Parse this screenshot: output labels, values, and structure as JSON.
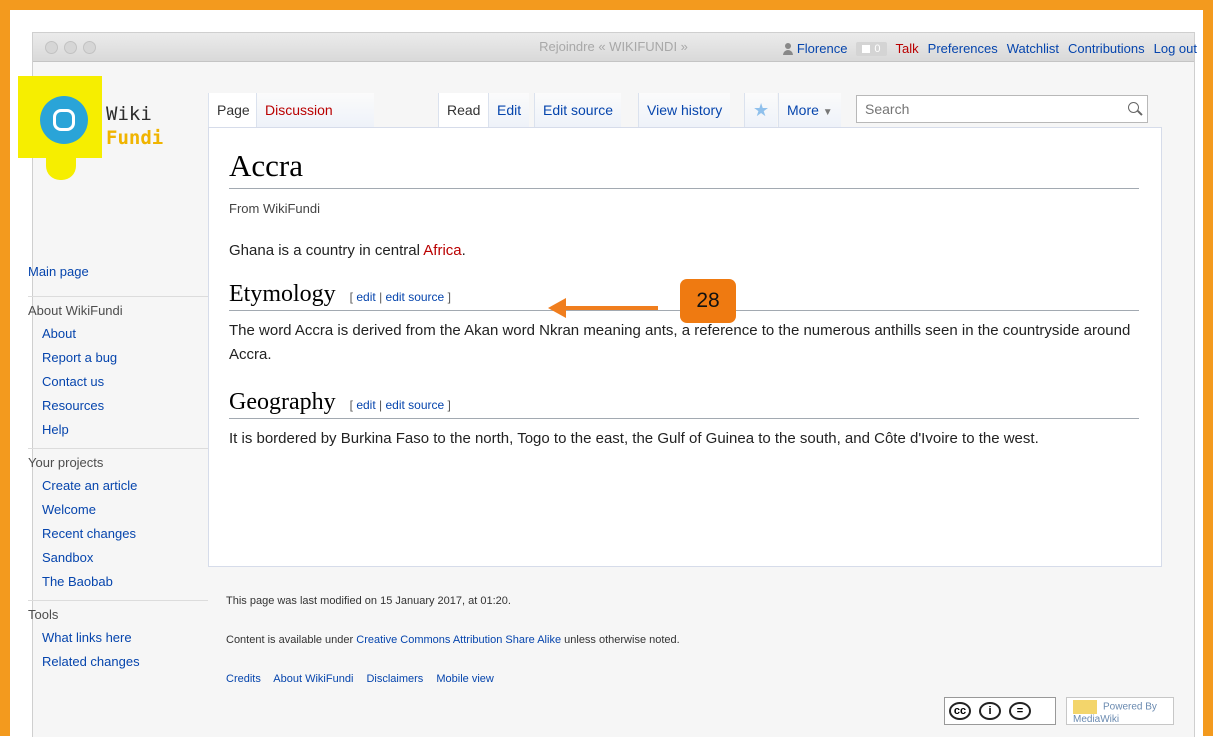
{
  "window": {
    "title": "Rejoindre « WIKIFUNDI »"
  },
  "personal": {
    "user": "Florence",
    "notifications": "0",
    "talk": "Talk",
    "preferences": "Preferences",
    "watchlist": "Watchlist",
    "contributions": "Contributions",
    "logout": "Log out"
  },
  "logo": {
    "line1": "Wiki",
    "line2": "Fundi"
  },
  "sidebar": {
    "main_page": "Main page",
    "sections": [
      {
        "title": "About WikiFundi",
        "items": [
          "About",
          "Report a bug",
          "Contact us",
          "Resources",
          "Help"
        ]
      },
      {
        "title": "Your projects",
        "items": [
          "Create an article",
          "Welcome",
          "Recent changes",
          "Sandbox",
          "The Baobab"
        ]
      },
      {
        "title": "Tools",
        "items": [
          "What links here",
          "Related changes"
        ]
      }
    ]
  },
  "tabs": {
    "page": "Page",
    "discussion": "Discussion",
    "read": "Read",
    "edit": "Edit",
    "edit_source": "Edit source",
    "view_history": "View history",
    "more": "More"
  },
  "search": {
    "placeholder": "Search"
  },
  "article": {
    "title": "Accra",
    "subtitle": "From WikiFundi",
    "intro_text": "Ghana is a country in central ",
    "intro_link": "Africa",
    "intro_end": ".",
    "sections": [
      {
        "heading": "Etymology",
        "text": "The word Accra is derived from the Akan word Nkran meaning ants, a reference to the numerous anthills seen in the countryside around Accra."
      },
      {
        "heading": "Geography",
        "text": "It is bordered by Burkina Faso to the north, Togo to the east, the Gulf of Guinea to the south, and Côte d'Ivoire to the west."
      }
    ],
    "edit_label": "edit",
    "edit_source_label": "edit source",
    "sep": "|",
    "open_bracket": "[",
    "close_bracket": "]"
  },
  "annotation": {
    "badge": "28",
    "color": "#f07e1e"
  },
  "footer": {
    "last_modified": "This page was last modified on 15 January 2017, at 01:20.",
    "license_prefix": "Content is available under ",
    "license_link": "Creative Commons Attribution Share Alike",
    "license_suffix": " unless otherwise noted.",
    "links": [
      "Credits",
      "About WikiFundi",
      "Disclaimers",
      "Mobile view"
    ],
    "cc_glyphs": [
      "cc",
      "i",
      "="
    ],
    "powered_by": "Powered By MediaWiki"
  }
}
